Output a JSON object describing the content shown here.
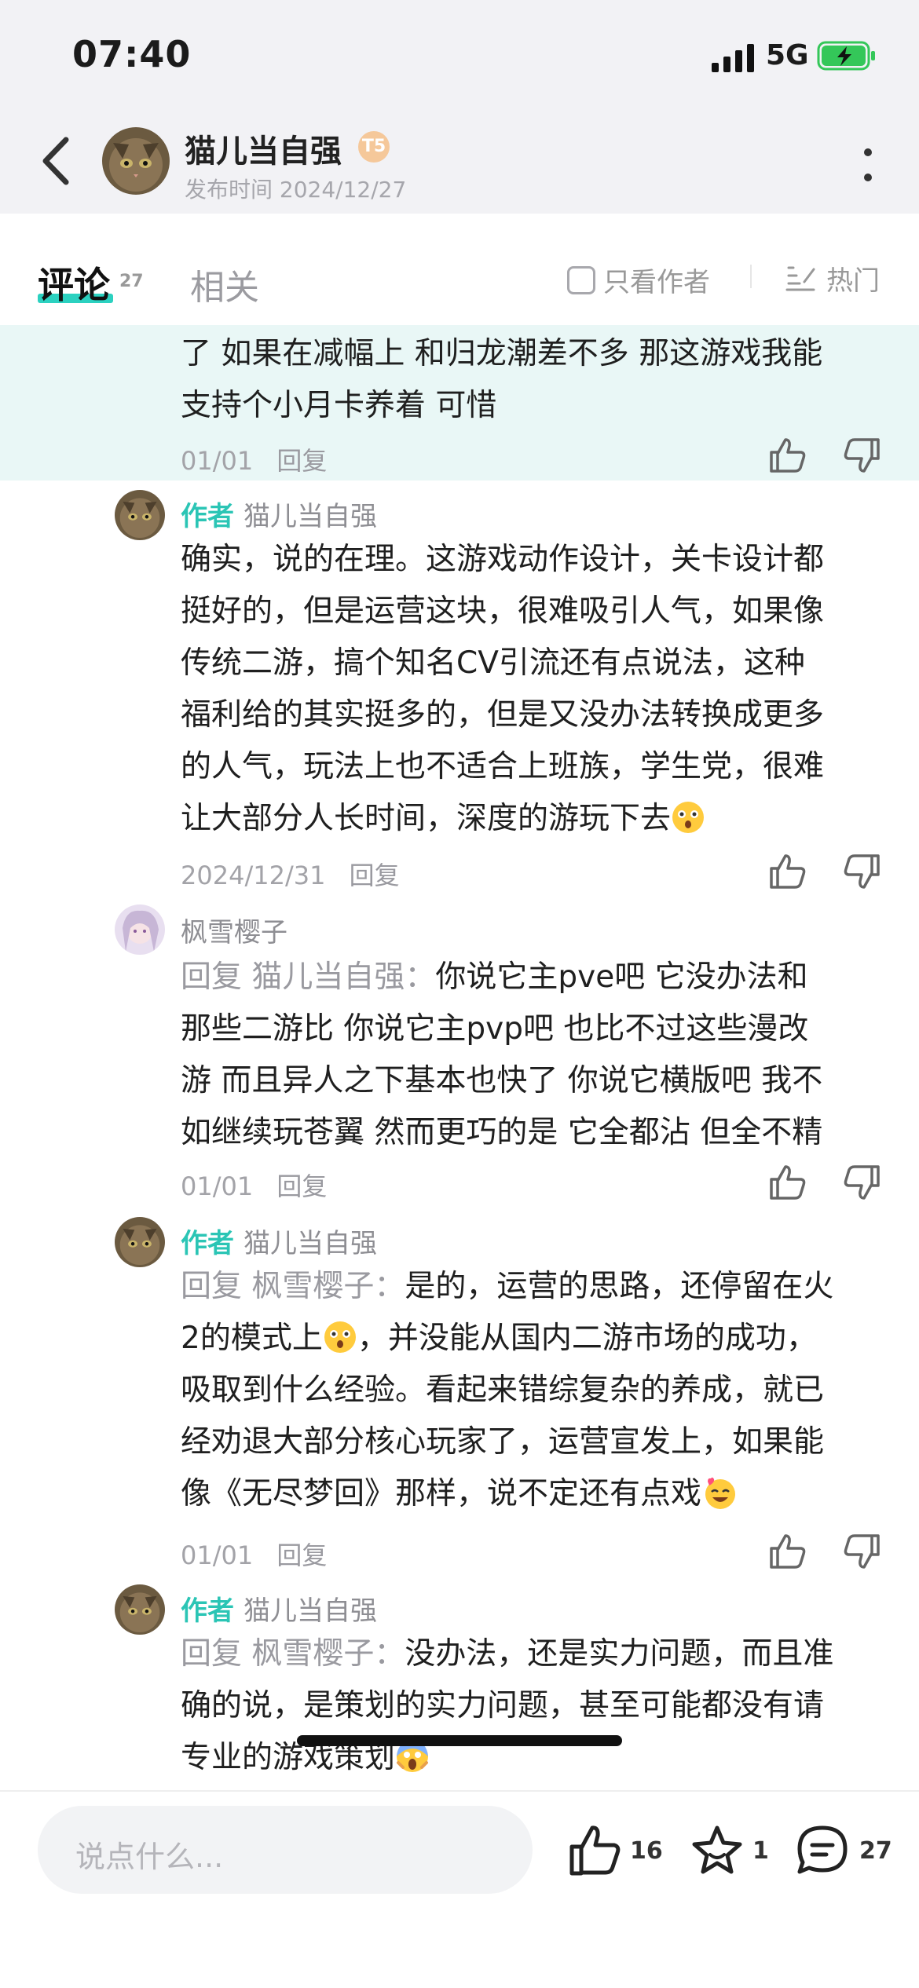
{
  "status_bar": {
    "time": "07:40",
    "network": "5G"
  },
  "header": {
    "author_name": "猫儿当自强",
    "level_badge": "T5",
    "post_time": "发布时间 2024/12/27"
  },
  "tabs": {
    "comments_label": "评论",
    "comments_count": "27",
    "related_label": "相关",
    "only_author_label": "只看作者",
    "sort_label": "热门"
  },
  "comments": [
    {
      "text_lines": [
        "了 如果在减幅上 和归龙潮差不多 那这游戏我能",
        "支持个小月卡养着 可惜"
      ],
      "date": "01/01",
      "reply_label": "回复"
    },
    {
      "author_tag": "作者",
      "name": "猫儿当自强",
      "text_lines": [
        "确实，说的在理。这游戏动作设计，关卡设计都",
        "挺好的，但是运营这块，很难吸引人气，如果像",
        "传统二游，搞个知名CV引流还有点说法，这种",
        "福利给的其实挺多的，但是又没办法转换成更多",
        "的人气，玩法上也不适合上班族，学生党，很难",
        "让大部分人长时间，深度的游玩下去"
      ],
      "date": "2024/12/31",
      "reply_label": "回复"
    },
    {
      "name": "枫雪樱子",
      "reply_prefix": "回复 猫儿当自强：",
      "text_lines": [
        "你说它主pve吧 它没办法和",
        "那些二游比 你说它主pvp吧 也比不过这些漫改",
        "游 而且异人之下基本也快了 你说它横版吧 我不",
        "如继续玩苍翼 然而更巧的是 它全都沾 但全不精"
      ],
      "date": "01/01",
      "reply_label": "回复"
    },
    {
      "author_tag": "作者",
      "name": "猫儿当自强",
      "reply_prefix": "回复 枫雪樱子：",
      "text_lines": [
        "是的，运营的思路，还停留在火",
        "2的模式上",
        "，并没能从国内二游市场的成功，",
        "吸取到什么经验。看起来错综复杂的养成，就已",
        "经劝退大部分核心玩家了，运营宣发上，如果能",
        "像《无尽梦回》那样，说不定还有点戏"
      ],
      "date": "01/01",
      "reply_label": "回复"
    },
    {
      "author_tag": "作者",
      "name": "猫儿当自强",
      "reply_prefix": "回复 枫雪樱子：",
      "text_lines": [
        "没办法，还是实力问题，而且准",
        "确的说，是策划的实力问题，甚至可能都没有请",
        "专业的游戏策划"
      ]
    }
  ],
  "bottom_bar": {
    "input_placeholder": "说点什么...",
    "like_count": "16",
    "favorite_count": "1",
    "comment_count": "27"
  },
  "colors": {
    "accent": "#2bc5b5",
    "highlight_bg": "#e9f7f6",
    "header_bg": "#f2f2f5"
  }
}
